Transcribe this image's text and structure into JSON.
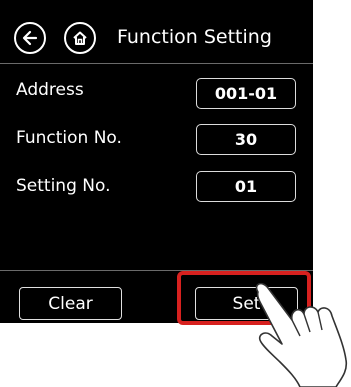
{
  "header": {
    "title": "Function Setting",
    "back_icon": "back-arrow-icon",
    "home_icon": "home-icon"
  },
  "rows": [
    {
      "label": "Address",
      "value": "001-01"
    },
    {
      "label": "Function No.",
      "value": "30"
    },
    {
      "label": "Setting No.",
      "value": "01"
    }
  ],
  "footer": {
    "clear_label": "Clear",
    "set_label": "Set"
  },
  "annotations": {
    "highlight_color": "#d7211f",
    "pointer_icon": "pointing-hand-icon"
  }
}
